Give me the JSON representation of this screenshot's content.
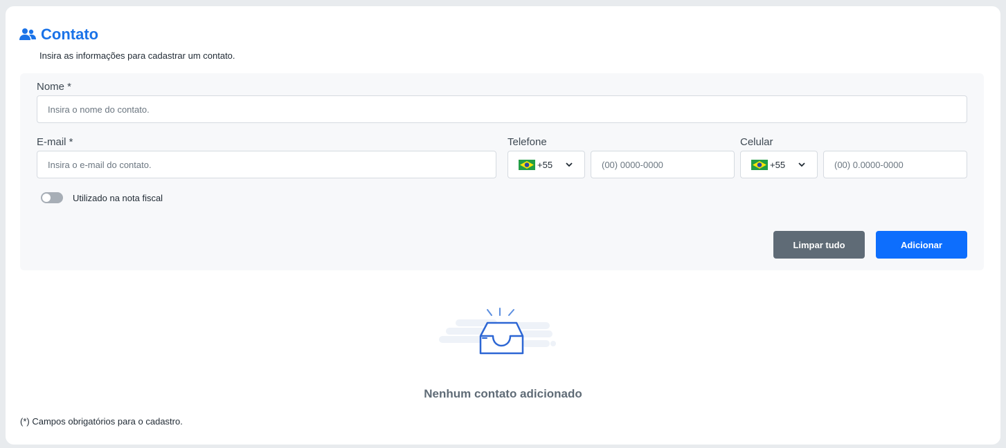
{
  "header": {
    "title": "Contato",
    "subtitle": "Insira as informações para cadastrar um contato.",
    "icon": "users-icon"
  },
  "form": {
    "name": {
      "label": "Nome *",
      "placeholder": "Insira o nome do contato.",
      "value": ""
    },
    "email": {
      "label": "E-mail *",
      "placeholder": "Insira o e-mail do contato.",
      "value": ""
    },
    "phone": {
      "label": "Telefone",
      "country_code": "+55",
      "country_flag": "brazil-flag-icon",
      "placeholder": "(00) 0000-0000",
      "value": ""
    },
    "mobile": {
      "label": "Celular",
      "country_code": "+55",
      "country_flag": "brazil-flag-icon",
      "placeholder": "(00) 0.0000-0000",
      "value": ""
    },
    "invoice_toggle": {
      "label": "Utilizado na nota fiscal",
      "checked": false
    },
    "buttons": {
      "clear": "Limpar tudo",
      "add": "Adicionar"
    }
  },
  "empty_state": {
    "text": "Nenhum contato adicionado",
    "icon": "empty-inbox-icon"
  },
  "footnote": "(*) Campos obrigatórios para o cadastro.",
  "colors": {
    "accent": "#1a73e8",
    "primary_button": "#0d6efd",
    "secondary_button": "#5f6b76",
    "panel_background": "#f7f8fa"
  }
}
